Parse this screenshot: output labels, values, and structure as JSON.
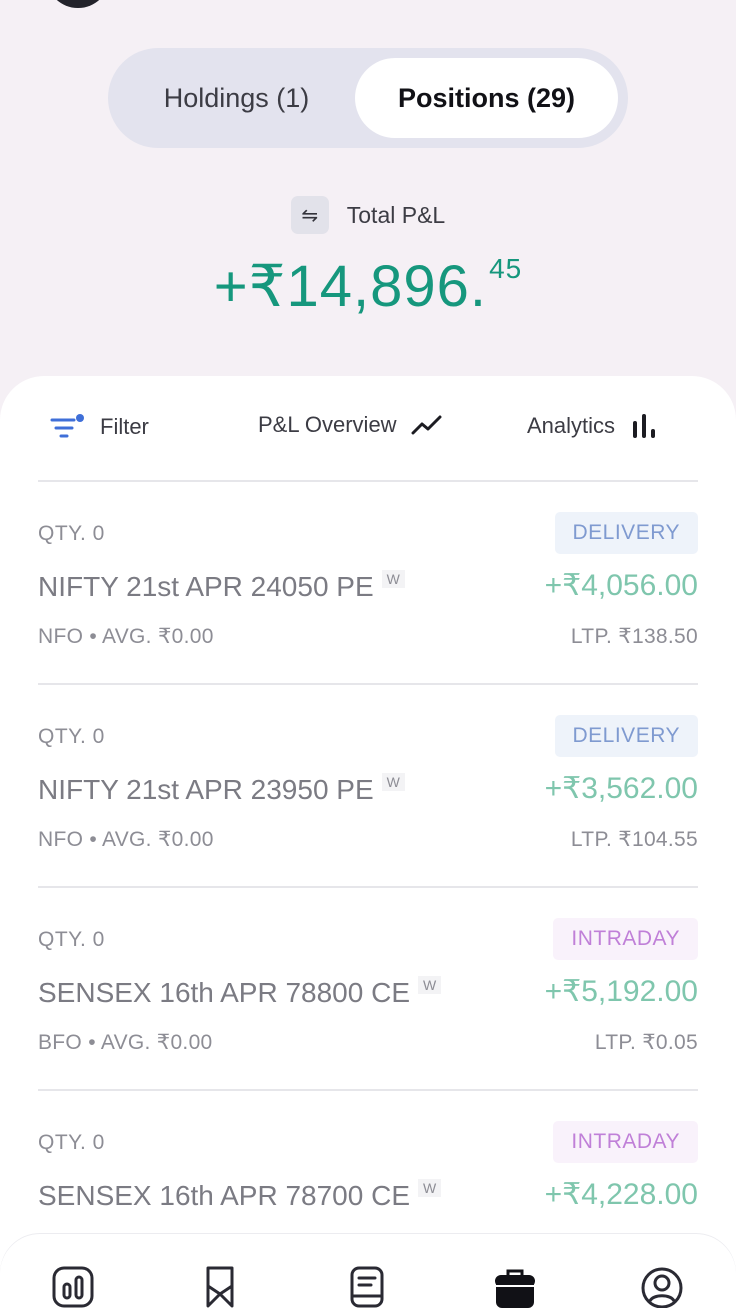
{
  "tabs": {
    "holdings_label": "Holdings (1)",
    "positions_label": "Positions (29)",
    "active": "positions"
  },
  "summary": {
    "label": "Total P&L",
    "value_main": "+₹14,896.",
    "value_decimal": "45",
    "color": "#16977d"
  },
  "toolbar": {
    "filter_label": "Filter",
    "overview_label": "P&L Overview",
    "analytics_label": "Analytics"
  },
  "positions": [
    {
      "qty": "QTY. 0",
      "badge": "DELIVERY",
      "badge_type": "delivery",
      "name": "NIFTY 21st APR 24050 PE",
      "tag": "W",
      "pnl": "+₹4,056.00",
      "meta": "NFO • AVG. ₹0.00",
      "ltp": "LTP. ₹138.50"
    },
    {
      "qty": "QTY. 0",
      "badge": "DELIVERY",
      "badge_type": "delivery",
      "name": "NIFTY 21st APR 23950 PE",
      "tag": "W",
      "pnl": "+₹3,562.00",
      "meta": "NFO • AVG. ₹0.00",
      "ltp": "LTP. ₹104.55"
    },
    {
      "qty": "QTY. 0",
      "badge": "INTRADAY",
      "badge_type": "intraday",
      "name": "SENSEX 16th APR 78800 CE",
      "tag": "W",
      "pnl": "+₹5,192.00",
      "meta": "BFO • AVG. ₹0.00",
      "ltp": "LTP. ₹0.05"
    },
    {
      "qty": "QTY. 0",
      "badge": "INTRADAY",
      "badge_type": "intraday",
      "name": "SENSEX 16th APR 78700 CE",
      "tag": "W",
      "pnl": "+₹4,228.00",
      "meta": "",
      "ltp": ""
    }
  ],
  "bottom_nav": [
    "markets-icon",
    "watchlist-icon",
    "orders-icon",
    "portfolio-icon",
    "profile-icon"
  ]
}
